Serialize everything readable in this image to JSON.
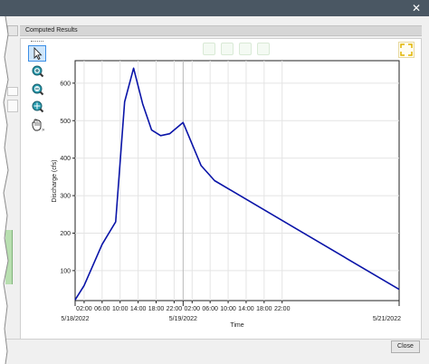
{
  "window": {
    "close_glyph": "✕",
    "tab_label": "Computed Results"
  },
  "toolbar": {
    "tools": [
      {
        "name": "pointer-tool",
        "icon": "pointer-icon",
        "active": true
      },
      {
        "name": "zoom-in-tool",
        "icon": "zoom-in-icon",
        "active": false
      },
      {
        "name": "zoom-out-tool",
        "icon": "zoom-out-icon",
        "active": false
      },
      {
        "name": "zoom-extents-tool",
        "icon": "zoom-extents-icon",
        "active": false
      },
      {
        "name": "pan-tool",
        "icon": "pan-hand-icon",
        "active": false
      }
    ],
    "more_glyph": "»",
    "expand_icon": "expand-icon"
  },
  "footer": {
    "close_label": "Close"
  },
  "colors": {
    "series": "#0a14a8",
    "titlebar": "#4a5763",
    "active_tool": "#3a8ee6"
  },
  "chart_data": {
    "type": "line",
    "xlabel": "Time",
    "ylabel": "Discharge (cfs)",
    "x_unit": "hours since 5/18/2022 00:00",
    "xlim_dates": [
      "5/18/2022",
      "5/21/2022"
    ],
    "ylim": [
      20,
      660
    ],
    "y_ticks": [
      100,
      200,
      300,
      400,
      500,
      600
    ],
    "x_minor_ticks": [
      "02:00",
      "06:00",
      "10:00",
      "14:00",
      "18:00",
      "22:00",
      "02:00",
      "06:00",
      "10:00",
      "14:00",
      "18:00",
      "22:00"
    ],
    "x_major_ticks": [
      "5/18/2022",
      "5/19/2022",
      "5/21/2022"
    ],
    "grid": true,
    "series": [
      {
        "x": [
          0.0,
          2.0,
          6.0,
          9.0,
          11.0,
          13.0,
          15.0,
          17.0,
          19.0,
          21.0,
          24.0,
          28.0,
          31.0,
          72.0
        ],
        "y": [
          22,
          60,
          170,
          230,
          550,
          640,
          545,
          475,
          460,
          465,
          495,
          380,
          340,
          50
        ]
      }
    ]
  }
}
